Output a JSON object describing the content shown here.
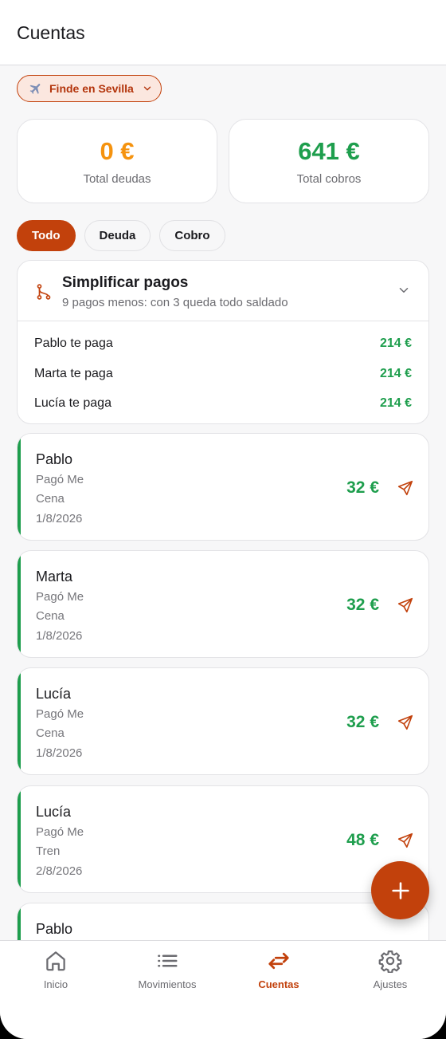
{
  "header": {
    "title": "Cuentas"
  },
  "group_selector": {
    "label": "Finde en Sevilla"
  },
  "summary": {
    "debt": {
      "amount": "0 €",
      "caption": "Total deudas"
    },
    "credit": {
      "amount": "641 €",
      "caption": "Total cobros"
    }
  },
  "filters": [
    {
      "label": "Todo"
    },
    {
      "label": "Deuda"
    },
    {
      "label": "Cobro"
    }
  ],
  "simplify": {
    "title": "Simplificar pagos",
    "subtitle": "9 pagos menos: con 3 queda todo saldado",
    "rows": [
      {
        "who": "Pablo te paga",
        "amount": "214 €"
      },
      {
        "who": "Marta te paga",
        "amount": "214 €"
      },
      {
        "who": "Lucía te paga",
        "amount": "214 €"
      }
    ]
  },
  "entries": [
    {
      "name": "Pablo",
      "payer": "Pagó Me",
      "concept": "Cena",
      "date": "1/8/2026",
      "amount": "32 €"
    },
    {
      "name": "Marta",
      "payer": "Pagó Me",
      "concept": "Cena",
      "date": "1/8/2026",
      "amount": "32 €"
    },
    {
      "name": "Lucía",
      "payer": "Pagó Me",
      "concept": "Cena",
      "date": "1/8/2026",
      "amount": "32 €"
    },
    {
      "name": "Lucía",
      "payer": "Pagó Me",
      "concept": "Tren",
      "date": "2/8/2026",
      "amount": "48 €"
    },
    {
      "name": "Pablo"
    }
  ],
  "nav": [
    {
      "label": "Inicio",
      "icon": "home-icon"
    },
    {
      "label": "Movimientos",
      "icon": "list-icon"
    },
    {
      "label": "Cuentas",
      "icon": "transfer-arrows-icon"
    },
    {
      "label": "Ajustes",
      "icon": "gear-icon"
    }
  ],
  "colors": {
    "accent": "#c2410c",
    "positive": "#1e9e4d",
    "debt": "#f5930f"
  }
}
